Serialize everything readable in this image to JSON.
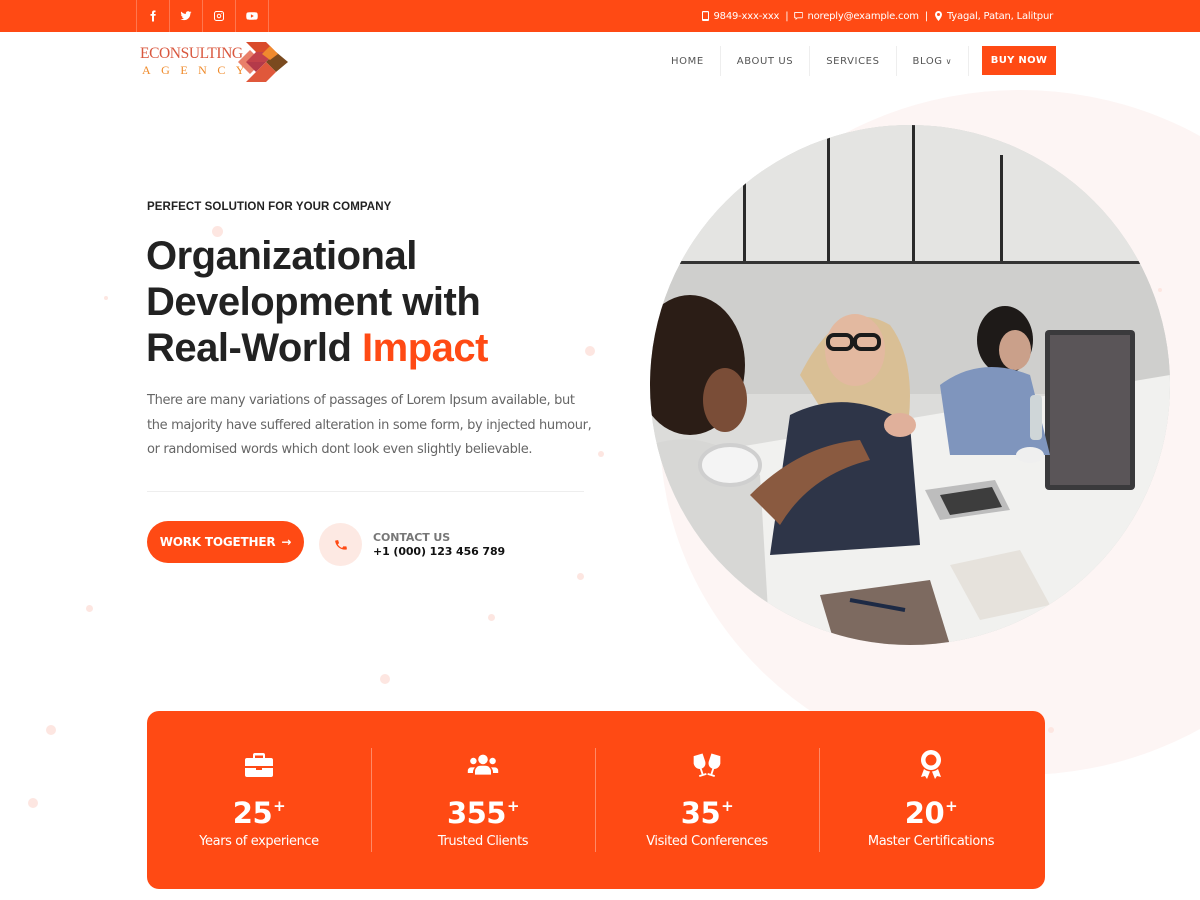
{
  "topbar": {
    "social": [
      {
        "name": "facebook-icon"
      },
      {
        "name": "twitter-icon"
      },
      {
        "name": "instagram-icon"
      },
      {
        "name": "youtube-icon"
      }
    ],
    "phone": "9849-xxx-xxx",
    "email": "noreply@example.com",
    "address": "Tyagal, Patan, Lalitpur",
    "separator": "|"
  },
  "header": {
    "logo_line1": "ECONSULTING",
    "logo_line2": "AGENCY",
    "nav": [
      {
        "label": "HOME"
      },
      {
        "label": "ABOUT US"
      },
      {
        "label": "SERVICES"
      },
      {
        "label": "BLOG",
        "has_dropdown": true
      }
    ],
    "dropdown_glyph": "⌄",
    "search_icon": "search-icon",
    "buy_label": "BUY NOW"
  },
  "hero": {
    "eyebrow": "PERFECT SOLUTION FOR YOUR COMPANY",
    "title_line1": "Organizational",
    "title_line2": "Development with",
    "title_line3_plain": "Real-World ",
    "title_line3_accent": "Impact",
    "description": "There are many variations of passages of Lorem Ipsum available, but the majority have suffered alteration in some form, by injected humour, or randomised words which dont look even slightly believable.",
    "cta_label": "WORK TOGETHER",
    "cta_arrow": "→",
    "contact_label": "CONTACT US",
    "contact_phone": "+1 (000) 123 456 789",
    "image_alt": "Team of coworkers talking at an office desk with laptops"
  },
  "stats": [
    {
      "icon": "briefcase-icon",
      "value": "25",
      "suffix": "+",
      "label": "Years of experience"
    },
    {
      "icon": "users-icon",
      "value": "355",
      "suffix": "+",
      "label": "Trusted Clients"
    },
    {
      "icon": "glasses-cheers-icon",
      "value": "35",
      "suffix": "+",
      "label": "Visited Conferences"
    },
    {
      "icon": "award-icon",
      "value": "20",
      "suffix": "+",
      "label": "Master Certifications"
    }
  ],
  "colors": {
    "accent": "#ff4a14",
    "text_dark": "#222222",
    "text_muted": "#666666",
    "soft_bg": "#fdf5f4"
  }
}
